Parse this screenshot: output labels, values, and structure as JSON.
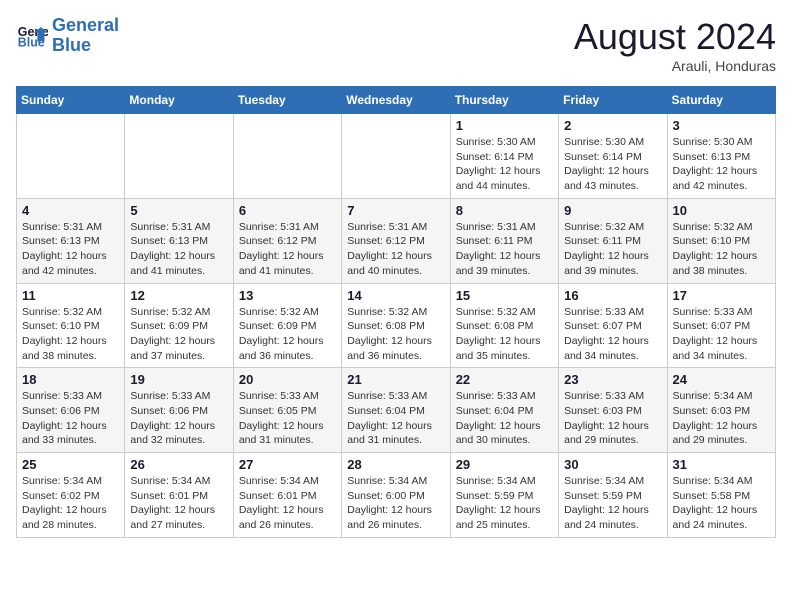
{
  "header": {
    "logo_line1": "General",
    "logo_line2": "Blue",
    "month_year": "August 2024",
    "location": "Arauli, Honduras"
  },
  "weekdays": [
    "Sunday",
    "Monday",
    "Tuesday",
    "Wednesday",
    "Thursday",
    "Friday",
    "Saturday"
  ],
  "weeks": [
    [
      {
        "day": "",
        "info": ""
      },
      {
        "day": "",
        "info": ""
      },
      {
        "day": "",
        "info": ""
      },
      {
        "day": "",
        "info": ""
      },
      {
        "day": "1",
        "info": "Sunrise: 5:30 AM\nSunset: 6:14 PM\nDaylight: 12 hours\nand 44 minutes."
      },
      {
        "day": "2",
        "info": "Sunrise: 5:30 AM\nSunset: 6:14 PM\nDaylight: 12 hours\nand 43 minutes."
      },
      {
        "day": "3",
        "info": "Sunrise: 5:30 AM\nSunset: 6:13 PM\nDaylight: 12 hours\nand 42 minutes."
      }
    ],
    [
      {
        "day": "4",
        "info": "Sunrise: 5:31 AM\nSunset: 6:13 PM\nDaylight: 12 hours\nand 42 minutes."
      },
      {
        "day": "5",
        "info": "Sunrise: 5:31 AM\nSunset: 6:13 PM\nDaylight: 12 hours\nand 41 minutes."
      },
      {
        "day": "6",
        "info": "Sunrise: 5:31 AM\nSunset: 6:12 PM\nDaylight: 12 hours\nand 41 minutes."
      },
      {
        "day": "7",
        "info": "Sunrise: 5:31 AM\nSunset: 6:12 PM\nDaylight: 12 hours\nand 40 minutes."
      },
      {
        "day": "8",
        "info": "Sunrise: 5:31 AM\nSunset: 6:11 PM\nDaylight: 12 hours\nand 39 minutes."
      },
      {
        "day": "9",
        "info": "Sunrise: 5:32 AM\nSunset: 6:11 PM\nDaylight: 12 hours\nand 39 minutes."
      },
      {
        "day": "10",
        "info": "Sunrise: 5:32 AM\nSunset: 6:10 PM\nDaylight: 12 hours\nand 38 minutes."
      }
    ],
    [
      {
        "day": "11",
        "info": "Sunrise: 5:32 AM\nSunset: 6:10 PM\nDaylight: 12 hours\nand 38 minutes."
      },
      {
        "day": "12",
        "info": "Sunrise: 5:32 AM\nSunset: 6:09 PM\nDaylight: 12 hours\nand 37 minutes."
      },
      {
        "day": "13",
        "info": "Sunrise: 5:32 AM\nSunset: 6:09 PM\nDaylight: 12 hours\nand 36 minutes."
      },
      {
        "day": "14",
        "info": "Sunrise: 5:32 AM\nSunset: 6:08 PM\nDaylight: 12 hours\nand 36 minutes."
      },
      {
        "day": "15",
        "info": "Sunrise: 5:32 AM\nSunset: 6:08 PM\nDaylight: 12 hours\nand 35 minutes."
      },
      {
        "day": "16",
        "info": "Sunrise: 5:33 AM\nSunset: 6:07 PM\nDaylight: 12 hours\nand 34 minutes."
      },
      {
        "day": "17",
        "info": "Sunrise: 5:33 AM\nSunset: 6:07 PM\nDaylight: 12 hours\nand 34 minutes."
      }
    ],
    [
      {
        "day": "18",
        "info": "Sunrise: 5:33 AM\nSunset: 6:06 PM\nDaylight: 12 hours\nand 33 minutes."
      },
      {
        "day": "19",
        "info": "Sunrise: 5:33 AM\nSunset: 6:06 PM\nDaylight: 12 hours\nand 32 minutes."
      },
      {
        "day": "20",
        "info": "Sunrise: 5:33 AM\nSunset: 6:05 PM\nDaylight: 12 hours\nand 31 minutes."
      },
      {
        "day": "21",
        "info": "Sunrise: 5:33 AM\nSunset: 6:04 PM\nDaylight: 12 hours\nand 31 minutes."
      },
      {
        "day": "22",
        "info": "Sunrise: 5:33 AM\nSunset: 6:04 PM\nDaylight: 12 hours\nand 30 minutes."
      },
      {
        "day": "23",
        "info": "Sunrise: 5:33 AM\nSunset: 6:03 PM\nDaylight: 12 hours\nand 29 minutes."
      },
      {
        "day": "24",
        "info": "Sunrise: 5:34 AM\nSunset: 6:03 PM\nDaylight: 12 hours\nand 29 minutes."
      }
    ],
    [
      {
        "day": "25",
        "info": "Sunrise: 5:34 AM\nSunset: 6:02 PM\nDaylight: 12 hours\nand 28 minutes."
      },
      {
        "day": "26",
        "info": "Sunrise: 5:34 AM\nSunset: 6:01 PM\nDaylight: 12 hours\nand 27 minutes."
      },
      {
        "day": "27",
        "info": "Sunrise: 5:34 AM\nSunset: 6:01 PM\nDaylight: 12 hours\nand 26 minutes."
      },
      {
        "day": "28",
        "info": "Sunrise: 5:34 AM\nSunset: 6:00 PM\nDaylight: 12 hours\nand 26 minutes."
      },
      {
        "day": "29",
        "info": "Sunrise: 5:34 AM\nSunset: 5:59 PM\nDaylight: 12 hours\nand 25 minutes."
      },
      {
        "day": "30",
        "info": "Sunrise: 5:34 AM\nSunset: 5:59 PM\nDaylight: 12 hours\nand 24 minutes."
      },
      {
        "day": "31",
        "info": "Sunrise: 5:34 AM\nSunset: 5:58 PM\nDaylight: 12 hours\nand 24 minutes."
      }
    ]
  ]
}
